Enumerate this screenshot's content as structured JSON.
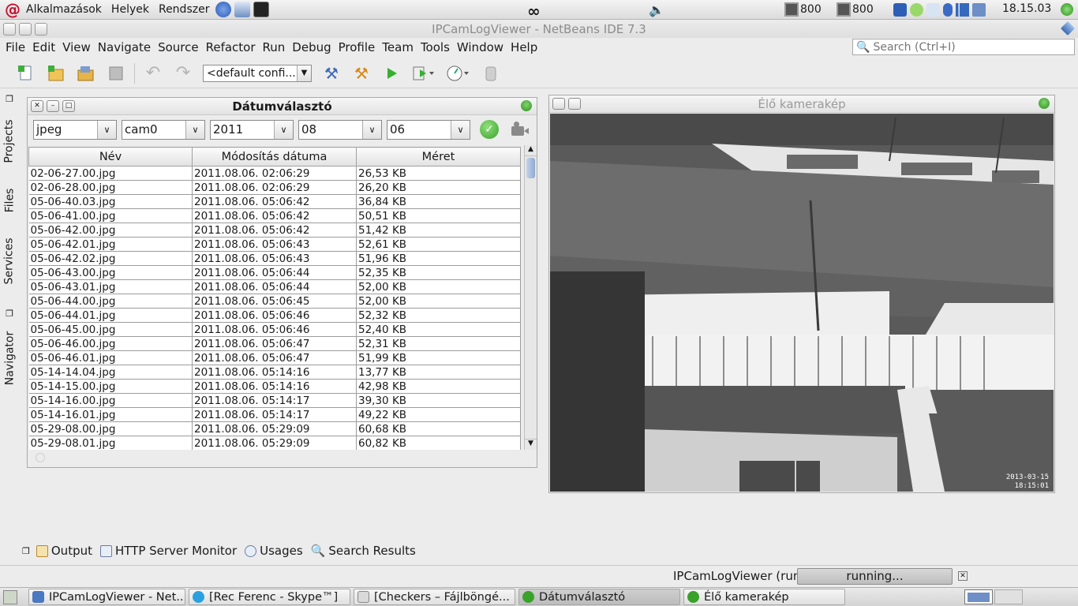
{
  "top_panel": {
    "apps_menu": "Alkalmazások",
    "places_menu": "Helyek",
    "system_menu": "Rendszer",
    "cpu1": "800",
    "cpu2": "800",
    "clock": "18.15.03"
  },
  "window": {
    "title": "IPCamLogViewer - NetBeans IDE 7.3"
  },
  "menubar": {
    "items": [
      "File",
      "Edit",
      "View",
      "Navigate",
      "Source",
      "Refactor",
      "Run",
      "Debug",
      "Profile",
      "Team",
      "Tools",
      "Window",
      "Help"
    ],
    "search_placeholder": "Search (Ctrl+I)"
  },
  "toolbar": {
    "config": "<default confi..."
  },
  "left_strip": {
    "tabs": [
      "Projects",
      "Files",
      "Services",
      "Navigator"
    ]
  },
  "date_panel": {
    "title": "Dátumválasztó",
    "filters": {
      "format": "jpeg",
      "camera": "cam0",
      "year": "2011",
      "month": "08",
      "day": "06"
    },
    "columns": [
      "Név",
      "Módosítás dátuma",
      "Méret"
    ],
    "rows": [
      [
        "02-06-27.00.jpg",
        "2011.08.06. 02:06:29",
        "26,53 KB"
      ],
      [
        "02-06-28.00.jpg",
        "2011.08.06. 02:06:29",
        "26,20 KB"
      ],
      [
        "05-06-40.03.jpg",
        "2011.08.06. 05:06:42",
        "36,84 KB"
      ],
      [
        "05-06-41.00.jpg",
        "2011.08.06. 05:06:42",
        "50,51 KB"
      ],
      [
        "05-06-42.00.jpg",
        "2011.08.06. 05:06:42",
        "51,42 KB"
      ],
      [
        "05-06-42.01.jpg",
        "2011.08.06. 05:06:43",
        "52,61 KB"
      ],
      [
        "05-06-42.02.jpg",
        "2011.08.06. 05:06:43",
        "51,96 KB"
      ],
      [
        "05-06-43.00.jpg",
        "2011.08.06. 05:06:44",
        "52,35 KB"
      ],
      [
        "05-06-43.01.jpg",
        "2011.08.06. 05:06:44",
        "52,00 KB"
      ],
      [
        "05-06-44.00.jpg",
        "2011.08.06. 05:06:45",
        "52,00 KB"
      ],
      [
        "05-06-44.01.jpg",
        "2011.08.06. 05:06:46",
        "52,32 KB"
      ],
      [
        "05-06-45.00.jpg",
        "2011.08.06. 05:06:46",
        "52,40 KB"
      ],
      [
        "05-06-46.00.jpg",
        "2011.08.06. 05:06:47",
        "52,31 KB"
      ],
      [
        "05-06-46.01.jpg",
        "2011.08.06. 05:06:47",
        "51,99 KB"
      ],
      [
        "05-14-14.04.jpg",
        "2011.08.06. 05:14:16",
        "13,77 KB"
      ],
      [
        "05-14-15.00.jpg",
        "2011.08.06. 05:14:16",
        "42,98 KB"
      ],
      [
        "05-14-16.00.jpg",
        "2011.08.06. 05:14:17",
        "39,30 KB"
      ],
      [
        "05-14-16.01.jpg",
        "2011.08.06. 05:14:17",
        "49,22 KB"
      ],
      [
        "05-29-08.00.jpg",
        "2011.08.06. 05:29:09",
        "60,68 KB"
      ],
      [
        "05-29-08.01.jpg",
        "2011.08.06. 05:29:09",
        "60,82 KB"
      ]
    ]
  },
  "camera_panel": {
    "title": "Élő kamerakép",
    "timestamp_date": "2013-03-15",
    "timestamp_time": "18:15:01"
  },
  "bottom_tabs": [
    "Output",
    "HTTP Server Monitor",
    "Usages",
    "Search Results"
  ],
  "status": {
    "task": "IPCamLogViewer (run)",
    "progress": "running..."
  },
  "taskbar": {
    "items": [
      "IPCamLogViewer - Net...",
      "[Rec Ferenc - Skype™]",
      "[Checkers – Fájlböngé...",
      "Dátumválasztó",
      "Élő kamerakép"
    ]
  },
  "colors": {
    "accent_green": "#3aa12a",
    "progress_gray": "#c9c9c9",
    "title_gray": "#8c8c8c"
  }
}
